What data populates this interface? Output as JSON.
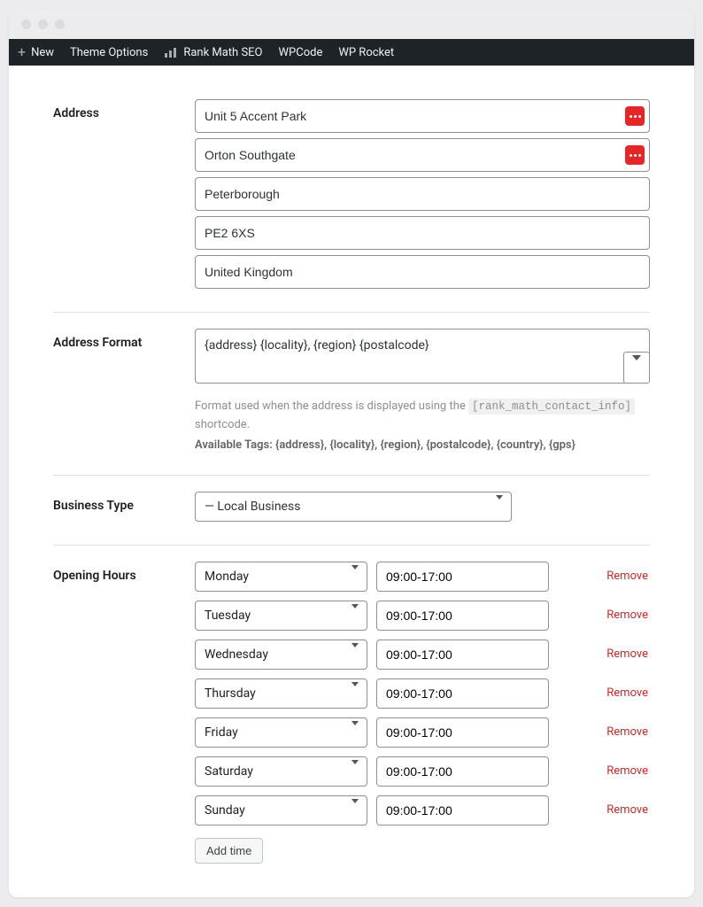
{
  "topbar": {
    "new": "New",
    "theme_options": "Theme Options",
    "rank_math": "Rank Math SEO",
    "wpcode": "WPCode",
    "wp_rocket": "WP Rocket"
  },
  "labels": {
    "address": "Address",
    "address_format": "Address Format",
    "business_type": "Business Type",
    "opening_hours": "Opening Hours"
  },
  "address": {
    "lines": [
      {
        "value": "Unit 5 Accent Park",
        "has_action": true
      },
      {
        "value": "Orton Southgate",
        "has_action": true
      },
      {
        "value": "Peterborough",
        "has_action": false
      },
      {
        "value": "PE2 6XS",
        "has_action": false
      },
      {
        "value": "United Kingdom",
        "has_action": false
      }
    ]
  },
  "address_format": {
    "value": "{address} {locality}, {region} {postalcode}",
    "help_prefix": "Format used when the address is displayed using the ",
    "shortcode": "[rank_math_contact_info]",
    "help_suffix": " shortcode.",
    "tags_label": "Available Tags: {address}, {locality}, {region}, {postalcode}, {country}, {gps}"
  },
  "business_type": {
    "selected": "— Local Business"
  },
  "opening_hours": {
    "rows": [
      {
        "day": "Monday",
        "time": "09:00-17:00"
      },
      {
        "day": "Tuesday",
        "time": "09:00-17:00"
      },
      {
        "day": "Wednesday",
        "time": "09:00-17:00"
      },
      {
        "day": "Thursday",
        "time": "09:00-17:00"
      },
      {
        "day": "Friday",
        "time": "09:00-17:00"
      },
      {
        "day": "Saturday",
        "time": "09:00-17:00"
      },
      {
        "day": "Sunday",
        "time": "09:00-17:00"
      }
    ],
    "remove_label": "Remove",
    "add_label": "Add time"
  }
}
